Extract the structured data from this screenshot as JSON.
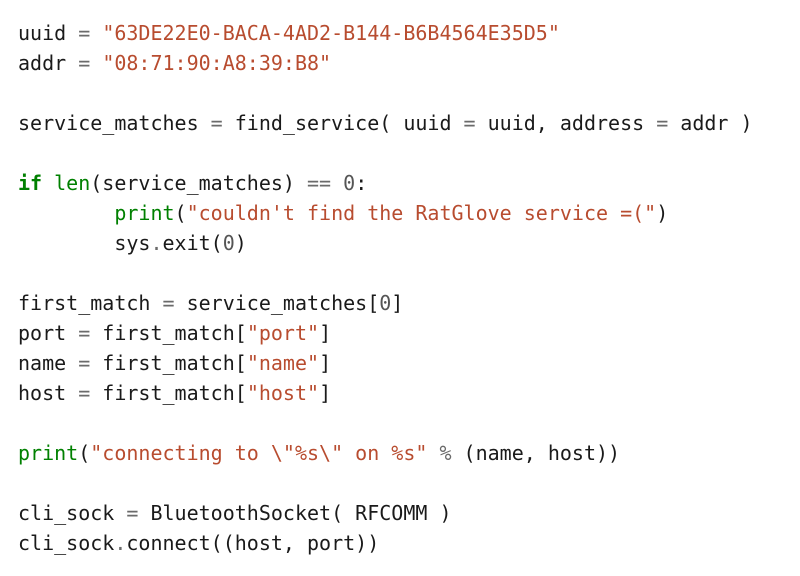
{
  "code": {
    "line01": {
      "a": "uuid ",
      "op": "=",
      "b": " ",
      "str": "\"63DE22E0-BACA-4AD2-B144-B6B4564E35D5\""
    },
    "line02": {
      "a": "addr ",
      "op": "=",
      "b": " ",
      "str": "\"08:71:90:A8:39:B8\""
    },
    "line04": {
      "a": "service_matches ",
      "op1": "=",
      "b": " find_service( uuid ",
      "op2": "=",
      "c": " uuid, address ",
      "op3": "=",
      "d": " addr )"
    },
    "line06": {
      "kw": "if",
      "a": " ",
      "bi": "len",
      "b": "(service_matches) ",
      "op": "==",
      "c": " ",
      "num": "0",
      "d": ":"
    },
    "line07": {
      "indent": "        ",
      "bi": "print",
      "a": "(",
      "str": "\"couldn't find the RatGlove service =(\"",
      "b": ")"
    },
    "line08": {
      "indent": "        ",
      "a": "sys",
      "op": ".",
      "b": "exit(",
      "num": "0",
      "c": ")"
    },
    "line10": {
      "a": "first_match ",
      "op": "=",
      "b": " service_matches[",
      "num": "0",
      "c": "]"
    },
    "line11": {
      "a": "port ",
      "op": "=",
      "b": " first_match[",
      "str": "\"port\"",
      "c": "]"
    },
    "line12": {
      "a": "name ",
      "op": "=",
      "b": " first_match[",
      "str": "\"name\"",
      "c": "]"
    },
    "line13": {
      "a": "host ",
      "op": "=",
      "b": " first_match[",
      "str": "\"host\"",
      "c": "]"
    },
    "line15": {
      "bi": "print",
      "a": "(",
      "str": "\"connecting to \\\"%s\\\" on %s\"",
      "b": " ",
      "op": "%",
      "c": " (name, host))"
    },
    "line17": {
      "a": "cli_sock ",
      "op": "=",
      "b": " BluetoothSocket( RFCOMM )"
    },
    "line18": {
      "a": "cli_sock",
      "op": ".",
      "b": "connect((host, port))"
    }
  }
}
